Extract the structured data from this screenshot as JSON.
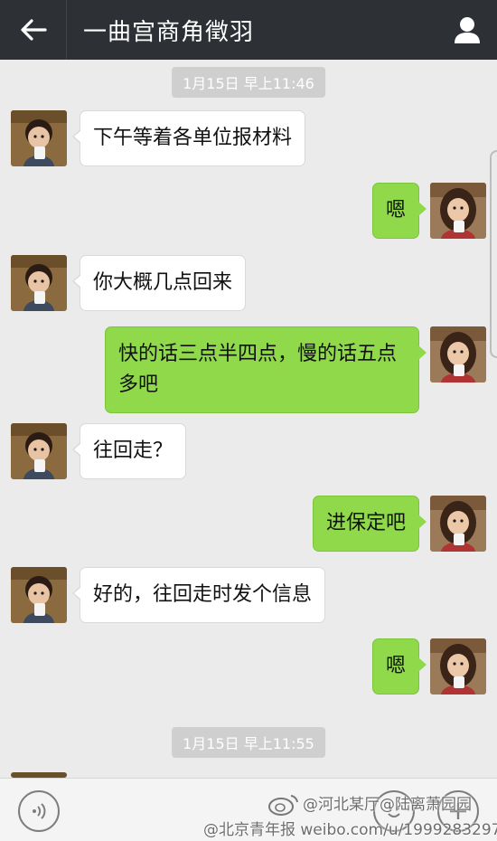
{
  "header": {
    "title": "一曲宫商角徵羽",
    "back_icon": "back-arrow-icon",
    "profile_icon": "person-icon",
    "background": "#2d3136"
  },
  "chat": {
    "timestamps": [
      "1月15日 早上11:46",
      "1月15日 早上11:55"
    ],
    "messages": [
      {
        "side": "in",
        "text": "下午等着各单位报材料"
      },
      {
        "side": "out",
        "text": "嗯"
      },
      {
        "side": "in",
        "text": "你大概几点回来"
      },
      {
        "side": "out",
        "text": "快的话三点半四点，慢的话五点多吧"
      },
      {
        "side": "in",
        "text": "往回走？"
      },
      {
        "side": "out",
        "text": "进保定吧"
      },
      {
        "side": "in",
        "text": "好的，往回走时发个信息"
      },
      {
        "side": "out",
        "text": "嗯"
      }
    ],
    "colors": {
      "incoming": "#ffffff",
      "outgoing": "#8fd94b",
      "background": "#ebebeb"
    }
  },
  "bottombar": {
    "voice_icon": "voice-icon",
    "emoji_icon": "emoji-icon",
    "plus_icon": "plus-icon"
  },
  "watermark": {
    "line1": "@河北某厅@陆离萧园园",
    "line2": "@北京青年报 weibo.com/u/1999283297"
  }
}
